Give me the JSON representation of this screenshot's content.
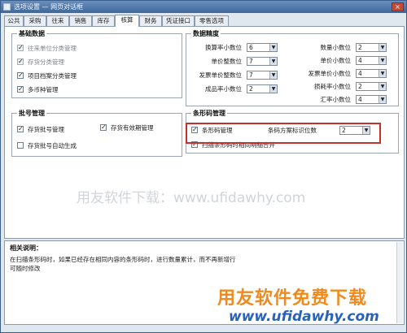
{
  "window": {
    "title": "选项设置 — 网页对话框",
    "close_label": "×"
  },
  "tabs": [
    {
      "label": "公共",
      "active": false
    },
    {
      "label": "采购",
      "active": false
    },
    {
      "label": "往来",
      "active": false
    },
    {
      "label": "销售",
      "active": false
    },
    {
      "label": "库存",
      "active": false
    },
    {
      "label": "核算",
      "active": true
    },
    {
      "label": "财务",
      "active": false
    },
    {
      "label": "凭证接口",
      "active": false
    },
    {
      "label": "零售选项",
      "active": false
    }
  ],
  "basic_data": {
    "title": "基础数据",
    "items": [
      {
        "label": "往来单位分类管理",
        "checked": true,
        "disabled": true
      },
      {
        "label": "存货分类管理",
        "checked": true,
        "disabled": true
      },
      {
        "label": "项目档案分类管理",
        "checked": true,
        "disabled": false
      },
      {
        "label": "多币种管理",
        "checked": true,
        "disabled": false
      }
    ]
  },
  "precision": {
    "title": "数据精度",
    "left": [
      {
        "label": "换算率小数位",
        "value": "6"
      },
      {
        "label": "单价整数位",
        "value": "7"
      },
      {
        "label": "发票单价整数位",
        "value": "7"
      },
      {
        "label": "成品率小数位",
        "value": "2"
      }
    ],
    "right": [
      {
        "label": "数量小数位",
        "value": "2"
      },
      {
        "label": "单价小数位",
        "value": "4"
      },
      {
        "label": "发票单价小数位",
        "value": "4"
      },
      {
        "label": "损耗率小数位",
        "value": "2"
      },
      {
        "label": "汇率小数位",
        "value": "4"
      }
    ],
    "arrow": "▼"
  },
  "batch": {
    "title": "批号管理",
    "items": [
      {
        "label": "存货批号管理",
        "checked": true
      },
      {
        "label": "存货有效期管理",
        "checked": true
      },
      {
        "label": "存货批号自动生成",
        "checked": false
      }
    ]
  },
  "barcode": {
    "title": "条形码管理",
    "manage_label": "条形码管理",
    "manage_checked": true,
    "digits_label": "条码方案标识位数",
    "digits_value": "2",
    "merge_label": "扫描条形码时相同明细合并",
    "merge_checked": true
  },
  "watermark": "用友软件下载：www.ufidawhy.com",
  "description": {
    "title": "相关说明：",
    "line1": "在扫描条形码时，如果已经存在相同内容的条形码时，进行数量累计，而不再新增行",
    "line2": "可随时修改"
  },
  "brand": {
    "line1": "用友软件免费下载",
    "line2": "www.ufidawhy.com"
  }
}
